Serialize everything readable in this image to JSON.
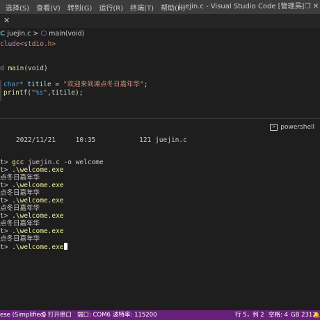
{
  "titlebar": {
    "menu": [
      "选择(S)",
      "查看(V)",
      "转到(G)",
      "运行(R)",
      "终端(T)",
      "帮助(H)"
    ],
    "window_title": "juejin.c - Visual Studio Code [管理员]",
    "controls": [
      "—",
      "❐",
      "✕"
    ]
  },
  "tab": {
    "close": "✕"
  },
  "breadcrumb": {
    "file_icon": "C",
    "file": "juejin.c",
    "separator": ">",
    "symbol_icon": "⬡",
    "symbol": "main(void)"
  },
  "editor": {
    "include_kw": "clude",
    "include_hdr": "<stdio.h>",
    "fn_prefix": "d ",
    "fn_name": "main",
    "fn_params": "(void)",
    "line1_type": "char*",
    "line1_var": "titile",
    "line1_eq": " = ",
    "line1_str": "\"欢迎来到滩点冬日嘉年华\"",
    "line1_end": ";",
    "line2_fn": "printf",
    "line2_open": "(",
    "line2_str_a": "\"",
    "line2_fmt": "%s",
    "line2_str_b": "\"",
    "line2_rest": ",titile);"
  },
  "terminal": {
    "label": "powershell",
    "icon": "terminal-icon",
    "dir_line": "    2022/11/21     10:35           121 juejin.c",
    "prompt": "t> ",
    "gcc_cmd": "gcc",
    "gcc_args": " juejin.c -o welcome",
    "run_cmd": ".\\welcome.exe",
    "output": "点冬日嘉年华"
  },
  "statusbar": {
    "encoding": "ese (Simplified)",
    "serial_open": "♀ 打开串口",
    "port": "端口: COM6",
    "baud": "波特率: 115200",
    "position": "行 5，列 2",
    "spaces": "空格: 4",
    "charset": "GB 2312",
    "bell": "🔔"
  },
  "colors": {
    "status_bg": "#68217a",
    "title_bg": "#3c3c3c",
    "editor_bg": "#1e1e1e"
  }
}
